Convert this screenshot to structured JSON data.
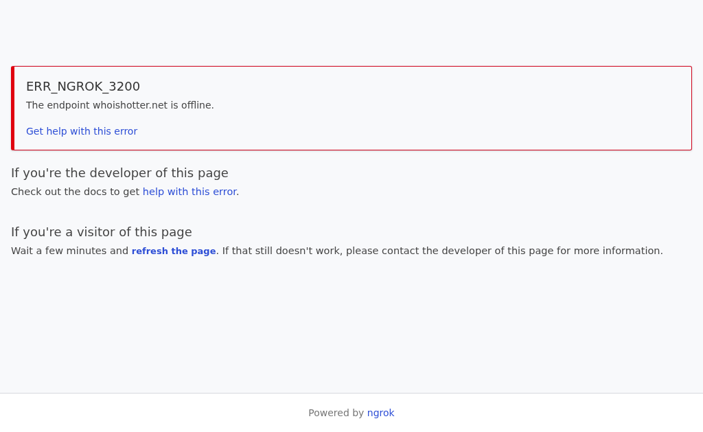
{
  "error_card": {
    "code": "ERR_NGROK_3200",
    "message": "The endpoint whoishotter.net is offline.",
    "help_link": "Get help with this error"
  },
  "sections": [
    {
      "heading": "If you're the developer of this page",
      "text_before": "Check out the docs to get ",
      "link": "help with this error",
      "link_bold": false,
      "text_after": "."
    },
    {
      "heading": "If you're a visitor of this page",
      "text_before": "Wait a few minutes and ",
      "link": "refresh the page",
      "link_bold": true,
      "text_after": ". If that still doesn't work, please contact the developer of this page for more information."
    }
  ],
  "footer": {
    "text": "Powered by ",
    "link": "ngrok"
  }
}
